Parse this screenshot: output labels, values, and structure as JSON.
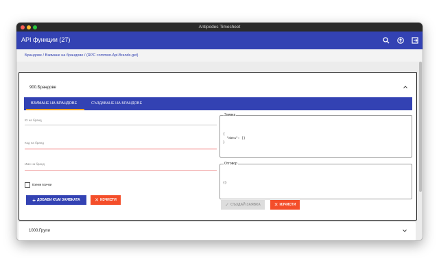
{
  "window": {
    "title": "Antipodes Timesheet"
  },
  "appbar": {
    "title": "API функции (27)",
    "icons": [
      "search-icon",
      "cloud-upload-icon",
      "logout-icon"
    ]
  },
  "breadcrumb": "Брандове / Взимане на брандове / (RPC common.Api.Brands.get)",
  "card1": {
    "title": "900.Брандове",
    "tabs": [
      "ВЗИМАНЕ НА БРАНДОВЕ",
      "СЪЗДАВАНЕ НА БРАНДОВЕ"
    ],
    "fields": {
      "id_label": "ID на бранд",
      "code_label": "Код на бранд",
      "name_label": "Име на бранд"
    },
    "checkbox_label": "Вземи всички",
    "buttons": {
      "add": "ДОБАВИ КЪМ ЗАЯВКАТА",
      "clear": "ИЗЧИСТИ",
      "create": "СЪЗДАЙ ЗАЯВКА",
      "clear2": "ИЗЧИСТИ"
    },
    "request": {
      "legend": "Заявка",
      "code_line1": "{",
      "code_line2": "  \"data\": []",
      "code_line3": "}"
    },
    "response": {
      "legend": "Отговор",
      "code": "{}"
    }
  },
  "card2": {
    "title": "1000.Групи"
  },
  "colors": {
    "primary": "#3342b3",
    "danger": "#f44e2a",
    "accent": "#f5a623"
  }
}
